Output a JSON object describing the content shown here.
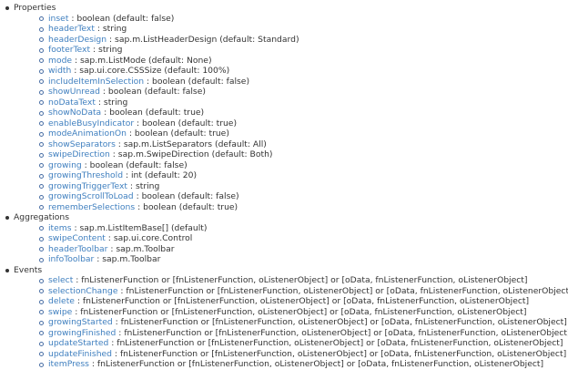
{
  "sections": [
    {
      "title": "Properties",
      "items": [
        {
          "name": "inset",
          "sig": " : boolean (default: false)"
        },
        {
          "name": "headerText",
          "sig": " : string"
        },
        {
          "name": "headerDesign",
          "sig": " : sap.m.ListHeaderDesign (default: Standard)"
        },
        {
          "name": "footerText",
          "sig": " : string"
        },
        {
          "name": "mode",
          "sig": " : sap.m.ListMode (default: None)"
        },
        {
          "name": "width",
          "sig": " : sap.ui.core.CSSSize (default: 100%)"
        },
        {
          "name": "includeItemInSelection",
          "sig": " : boolean (default: false)"
        },
        {
          "name": "showUnread",
          "sig": " : boolean (default: false)"
        },
        {
          "name": "noDataText",
          "sig": " : string"
        },
        {
          "name": "showNoData",
          "sig": " : boolean (default: true)"
        },
        {
          "name": "enableBusyIndicator",
          "sig": " : boolean (default: true)"
        },
        {
          "name": "modeAnimationOn",
          "sig": " : boolean (default: true)"
        },
        {
          "name": "showSeparators",
          "sig": " : sap.m.ListSeparators (default: All)"
        },
        {
          "name": "swipeDirection",
          "sig": " : sap.m.SwipeDirection (default: Both)"
        },
        {
          "name": "growing",
          "sig": " : boolean (default: false)"
        },
        {
          "name": "growingThreshold",
          "sig": " : int (default: 20)"
        },
        {
          "name": "growingTriggerText",
          "sig": " : string"
        },
        {
          "name": "growingScrollToLoad",
          "sig": " : boolean (default: false)"
        },
        {
          "name": "rememberSelections",
          "sig": " : boolean (default: true)"
        }
      ]
    },
    {
      "title": "Aggregations",
      "items": [
        {
          "name": "items",
          "sig": " : sap.m.ListItemBase[] (default)"
        },
        {
          "name": "swipeContent",
          "sig": " : sap.ui.core.Control"
        },
        {
          "name": "headerToolbar",
          "sig": " : sap.m.Toolbar"
        },
        {
          "name": "infoToolbar",
          "sig": " : sap.m.Toolbar"
        }
      ]
    },
    {
      "title": "Events",
      "items": [
        {
          "name": "select",
          "sig": " : fnListenerFunction or [fnListenerFunction, oListenerObject] or [oData, fnListenerFunction, oListenerObject]"
        },
        {
          "name": "selectionChange",
          "sig": " : fnListenerFunction or [fnListenerFunction, oListenerObject] or [oData, fnListenerFunction, oListenerObject]"
        },
        {
          "name": "delete",
          "sig": " : fnListenerFunction or [fnListenerFunction, oListenerObject] or [oData, fnListenerFunction, oListenerObject]"
        },
        {
          "name": "swipe",
          "sig": " : fnListenerFunction or [fnListenerFunction, oListenerObject] or [oData, fnListenerFunction, oListenerObject]"
        },
        {
          "name": "growingStarted",
          "sig": " : fnListenerFunction or [fnListenerFunction, oListenerObject] or [oData, fnListenerFunction, oListenerObject]"
        },
        {
          "name": "growingFinished",
          "sig": " : fnListenerFunction or [fnListenerFunction, oListenerObject] or [oData, fnListenerFunction, oListenerObject]"
        },
        {
          "name": "updateStarted",
          "sig": " : fnListenerFunction or [fnListenerFunction, oListenerObject] or [oData, fnListenerFunction, oListenerObject]"
        },
        {
          "name": "updateFinished",
          "sig": " : fnListenerFunction or [fnListenerFunction, oListenerObject] or [oData, fnListenerFunction, oListenerObject]"
        },
        {
          "name": "itemPress",
          "sig": " : fnListenerFunction or [fnListenerFunction, oListenerObject] or [oData, fnListenerFunction, oListenerObject]"
        }
      ]
    }
  ]
}
